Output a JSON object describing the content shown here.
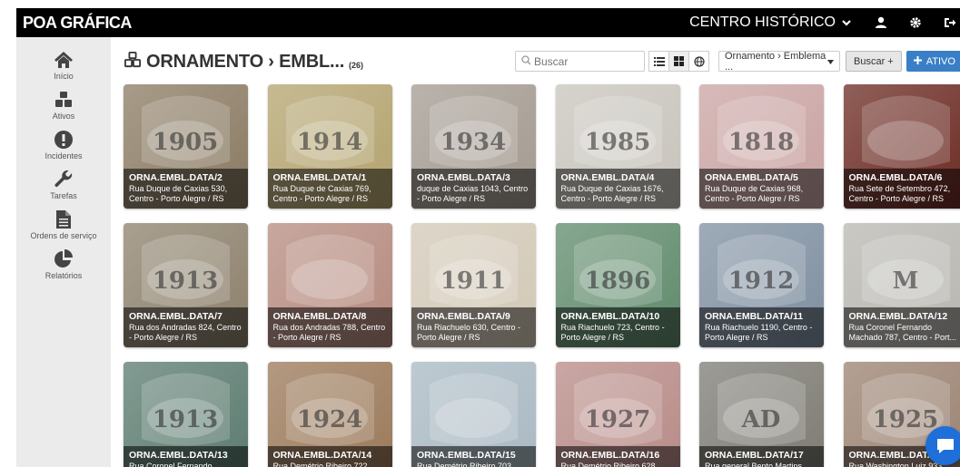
{
  "app": {
    "brand": "POA GRÁFICA"
  },
  "header": {
    "district": "CENTRO HISTÓRICO"
  },
  "sidebar": {
    "items": [
      {
        "label": "Início",
        "icon": "home-icon"
      },
      {
        "label": "Ativos",
        "icon": "cubes-icon"
      },
      {
        "label": "Incidentes",
        "icon": "exclamation-icon"
      },
      {
        "label": "Tarefas",
        "icon": "wrench-icon"
      },
      {
        "label": "Ordens de serviço",
        "icon": "file-icon"
      },
      {
        "label": "Relatórios",
        "icon": "pie-chart-icon"
      }
    ]
  },
  "main": {
    "title": "ORNAMENTO › EMBL...",
    "count": "(26)",
    "search_placeholder": "Buscar",
    "filter_value": "Ornamento › Emblema ...",
    "search_button": "Buscar +",
    "add_button": "ATIVO"
  },
  "cards": [
    {
      "id": "ORNA.EMBL.DATA/2",
      "addr": "Rua Duque de Caxias 530, Centro - Porto Alegre / RS",
      "bg": "#8a7a62",
      "text": "1905"
    },
    {
      "id": "ORNA.EMBL.DATA/1",
      "addr": "Rua Duque de Caxias 769, Centro - Porto Alegre / RS",
      "bg": "#b3a36e",
      "text": "1914"
    },
    {
      "id": "ORNA.EMBL.DATA/3",
      "addr": "duque de Caxias 1043, Centro - Porto Alegre / RS",
      "bg": "#a39a90",
      "text": "1934"
    },
    {
      "id": "ORNA.EMBL.DATA/4",
      "addr": "Rua Duque de Caxias 1676, Centro - Porto Alegre / RS",
      "bg": "#c8c4bc",
      "text": "1985"
    },
    {
      "id": "ORNA.EMBL.DATA/5",
      "addr": "Rua Duque de Caxias 968, Centro - Porto Alegre / RS",
      "bg": "#c9a3a2",
      "text": "1818"
    },
    {
      "id": "ORNA.EMBL.DATA/6",
      "addr": "Rua Sete de Setembro 472, Centro - Porto Alegre / RS",
      "bg": "#6b2a22",
      "text": ""
    },
    {
      "id": "ORNA.EMBL.DATA/7",
      "addr": "Rua dos Andradas 824, Centro - Porto Alegre / RS",
      "bg": "#8c806b",
      "text": "1913"
    },
    {
      "id": "ORNA.EMBL.DATA/8",
      "addr": "Rua dos Andradas 788, Centro - Porto Alegre / RS",
      "bg": "#b58a7e",
      "text": ""
    },
    {
      "id": "ORNA.EMBL.DATA/9",
      "addr": "Rua Riachuelo 630, Centro - Porto Alegre / RS",
      "bg": "#d2c8b6",
      "text": "1911"
    },
    {
      "id": "ORNA.EMBL.DATA/10",
      "addr": "Rua Riachuelo 723, Centro - Porto Alegre / RS",
      "bg": "#5f8a6b",
      "text": "1896"
    },
    {
      "id": "ORNA.EMBL.DATA/11",
      "addr": "Rua Riachuelo 1190, Centro - Porto Alegre / RS",
      "bg": "#7e8fa0",
      "text": "1912"
    },
    {
      "id": "ORNA.EMBL.DATA/12",
      "addr": "Rua Coronel Fernando Machado 787, Centro - Port...",
      "bg": "#b8b6b0",
      "text": "M"
    },
    {
      "id": "ORNA.EMBL.DATA/13",
      "addr": "Rua Coronel Fernando",
      "bg": "#5a7a6e",
      "text": "1913"
    },
    {
      "id": "ORNA.EMBL.DATA/14",
      "addr": "Rua Demétrio Ribeiro 722",
      "bg": "#9a7858",
      "text": "1924"
    },
    {
      "id": "ORNA.EMBL.DATA/15",
      "addr": "Rua Demétrio Ribeiro 703",
      "bg": "#a8b8c2",
      "text": ""
    },
    {
      "id": "ORNA.EMBL.DATA/16",
      "addr": "Rua Demétrio Ribeiro 628",
      "bg": "#b78a86",
      "text": "1927"
    },
    {
      "id": "ORNA.EMBL.DATA/17",
      "addr": "Rua general Bento Martins",
      "bg": "#7c7a72",
      "text": "AD"
    },
    {
      "id": "ORNA.EMBL.DAT...",
      "addr": "Rua Washington Luiz 933",
      "bg": "#9a8170",
      "text": "1925"
    }
  ]
}
